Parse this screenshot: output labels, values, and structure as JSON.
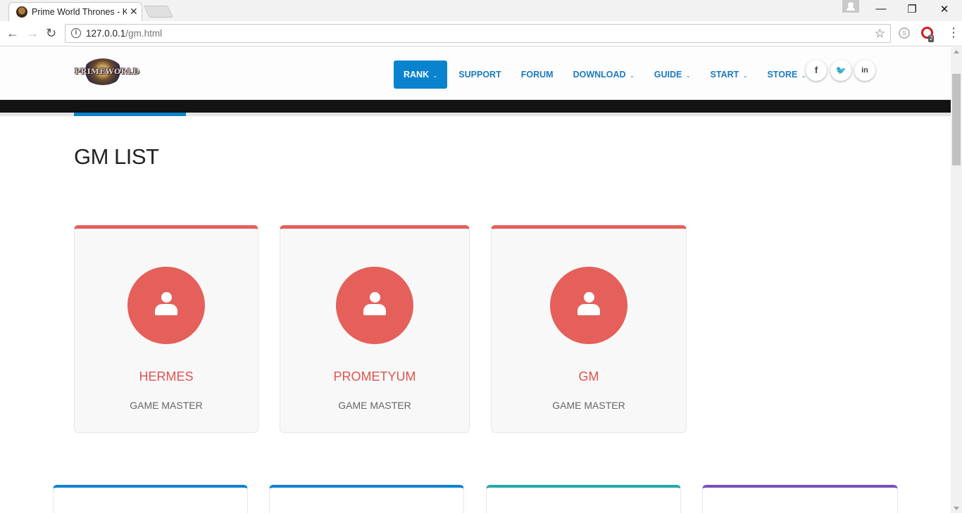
{
  "browser": {
    "tab_title": "Prime World Thrones - K",
    "tab_close": "✕",
    "url_host": "127.0.0.1",
    "url_path": "/gm.html",
    "window_controls": {
      "minimize": "—",
      "restore": "❐",
      "close": "✕"
    },
    "extension_badge": "2",
    "icons": [
      "back-icon",
      "forward-icon",
      "reload-icon",
      "info-icon",
      "star-icon",
      "skype-icon",
      "opera-icon",
      "menu-icon"
    ]
  },
  "site": {
    "logo_text": "PRIMEWORLD",
    "nav": [
      {
        "label": "RANK",
        "caret": "⌄",
        "active": true
      },
      {
        "label": "SUPPORT",
        "caret": ""
      },
      {
        "label": "FORUM",
        "caret": ""
      },
      {
        "label": "DOWNLOAD",
        "caret": "⌄"
      },
      {
        "label": "GUIDE",
        "caret": "⌄"
      },
      {
        "label": "START",
        "caret": "⌄"
      },
      {
        "label": "STORE",
        "caret": "⌄"
      }
    ],
    "social": [
      {
        "icon": "facebook-icon",
        "glyph": "f"
      },
      {
        "icon": "twitter-icon",
        "glyph": "🐦"
      },
      {
        "icon": "linkedin-icon",
        "glyph": "in"
      }
    ]
  },
  "page": {
    "title": "GM LIST",
    "gms": [
      {
        "name": "HERMES",
        "role": "GAME MASTER"
      },
      {
        "name": "PROMETYUM",
        "role": "GAME MASTER"
      },
      {
        "name": "GM",
        "role": "GAME MASTER"
      }
    ]
  },
  "colors": {
    "accent": "#0a83cf",
    "card_accent": "#e5605a",
    "bottom_cards": [
      "#0a83cf",
      "#0a83cf",
      "#26a9a9",
      "#7b4fbd"
    ]
  }
}
